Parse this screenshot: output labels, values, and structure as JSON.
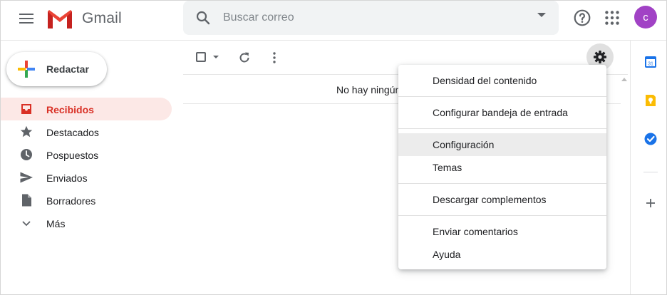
{
  "header": {
    "app_name": "Gmail",
    "search_placeholder": "Buscar correo",
    "avatar_letter": "c"
  },
  "sidebar": {
    "compose_label": "Redactar",
    "items": [
      {
        "label": "Recibidos",
        "icon": "inbox-icon",
        "active": true
      },
      {
        "label": "Destacados",
        "icon": "star-icon"
      },
      {
        "label": "Pospuestos",
        "icon": "clock-icon"
      },
      {
        "label": "Enviados",
        "icon": "send-icon"
      },
      {
        "label": "Borradores",
        "icon": "draft-icon"
      },
      {
        "label": "Más",
        "icon": "chevron-down-icon"
      }
    ]
  },
  "main": {
    "empty_text": "No hay ningún"
  },
  "side_panel": {
    "calendar_day": "31"
  },
  "settings_menu": {
    "items": [
      "Densidad del contenido",
      "Configurar bandeja de entrada",
      "Configuración",
      "Temas",
      "Descargar complementos",
      "Enviar comentarios",
      "Ayuda"
    ]
  },
  "colors": {
    "accent_red": "#d93025",
    "active_bg": "#fce8e6",
    "avatar": "#a142c5"
  }
}
